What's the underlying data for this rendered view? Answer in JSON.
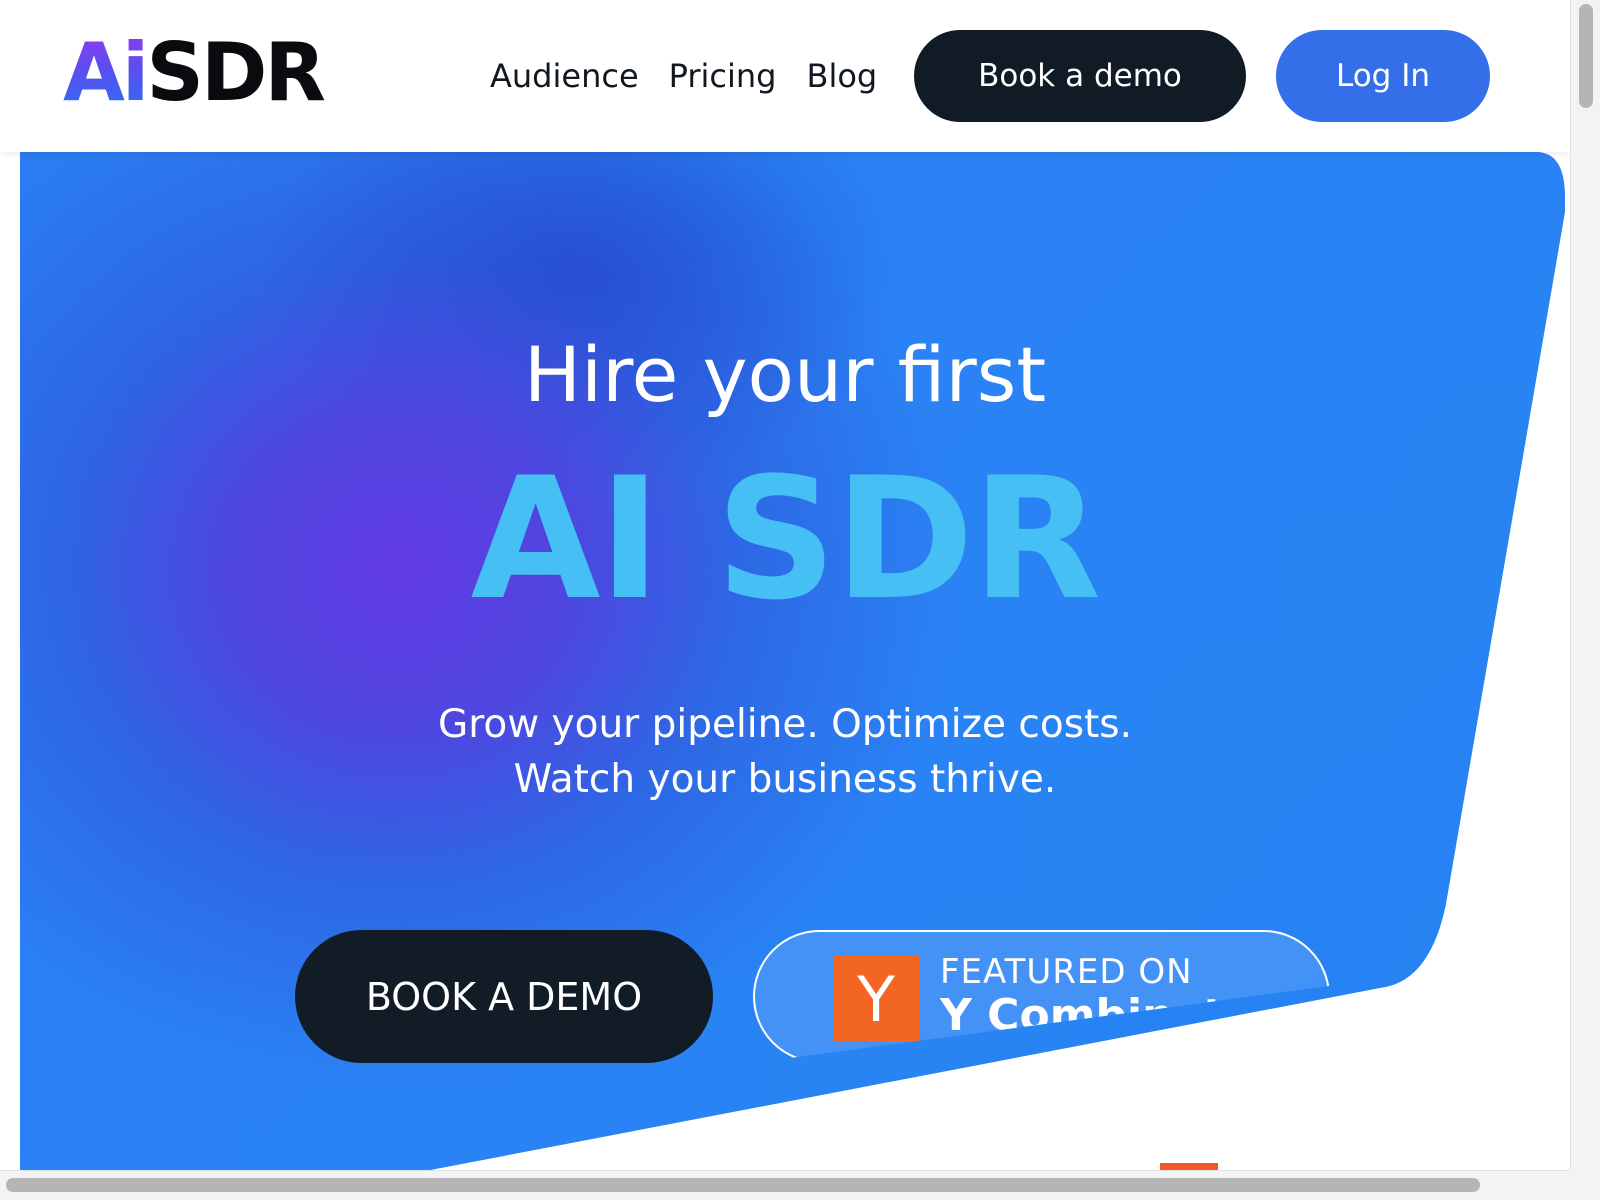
{
  "brand": {
    "logo_ai": "Ai",
    "logo_sdr": "SDR",
    "colors": {
      "logo_gradient_top": "#8b3df0",
      "logo_gradient_bottom": "#2f6df2",
      "dark": "#101b25",
      "login_blue": "#356ee9",
      "hero_blue": "#2a83f4",
      "hero_purple": "#623ae4",
      "headline_cyan": "#46c0f4",
      "yc_orange": "#f26522"
    }
  },
  "nav": {
    "links": [
      "Audience",
      "Pricing",
      "Blog"
    ],
    "book_demo_label": "Book a demo",
    "login_label": "Log In"
  },
  "hero": {
    "title_line1": "Hire your first",
    "title_line2": "AI SDR",
    "subtitle_line1": "Grow your pipeline. Optimize costs.",
    "subtitle_line2": "Watch your business thrive.",
    "cta_label": "BOOK A DEMO",
    "yc_badge": {
      "logo_letter": "Y",
      "label": "FEATURED ON",
      "name": "Y Combinator",
      "icon": "y-combinator-logo-icon"
    }
  }
}
